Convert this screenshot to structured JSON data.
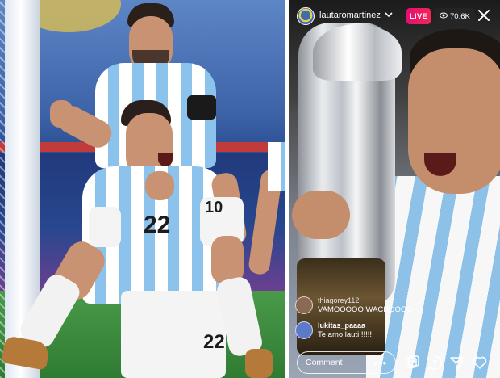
{
  "left_photo": {
    "player_front_number": "22",
    "player_back_number": "10",
    "shorts_number": "22"
  },
  "live": {
    "username": "lautaromartinez",
    "live_badge": "LIVE",
    "viewer_count": "70.6K",
    "comments": [
      {
        "user": "thiagorey112",
        "message": "VAMOOOOO WACHOOOO",
        "avatar_color": "#8a6a55"
      },
      {
        "user": "lukitas_paaaa",
        "message": "Te amo lauti!!!!!!",
        "avatar_color": "#5b7ac7"
      }
    ],
    "comment_placeholder": "Comment",
    "more_label": "•••"
  },
  "icons": [
    "chevron-down-icon",
    "eye-icon",
    "close-icon",
    "add-media-icon",
    "question-icon",
    "send-icon",
    "heart-icon"
  ]
}
